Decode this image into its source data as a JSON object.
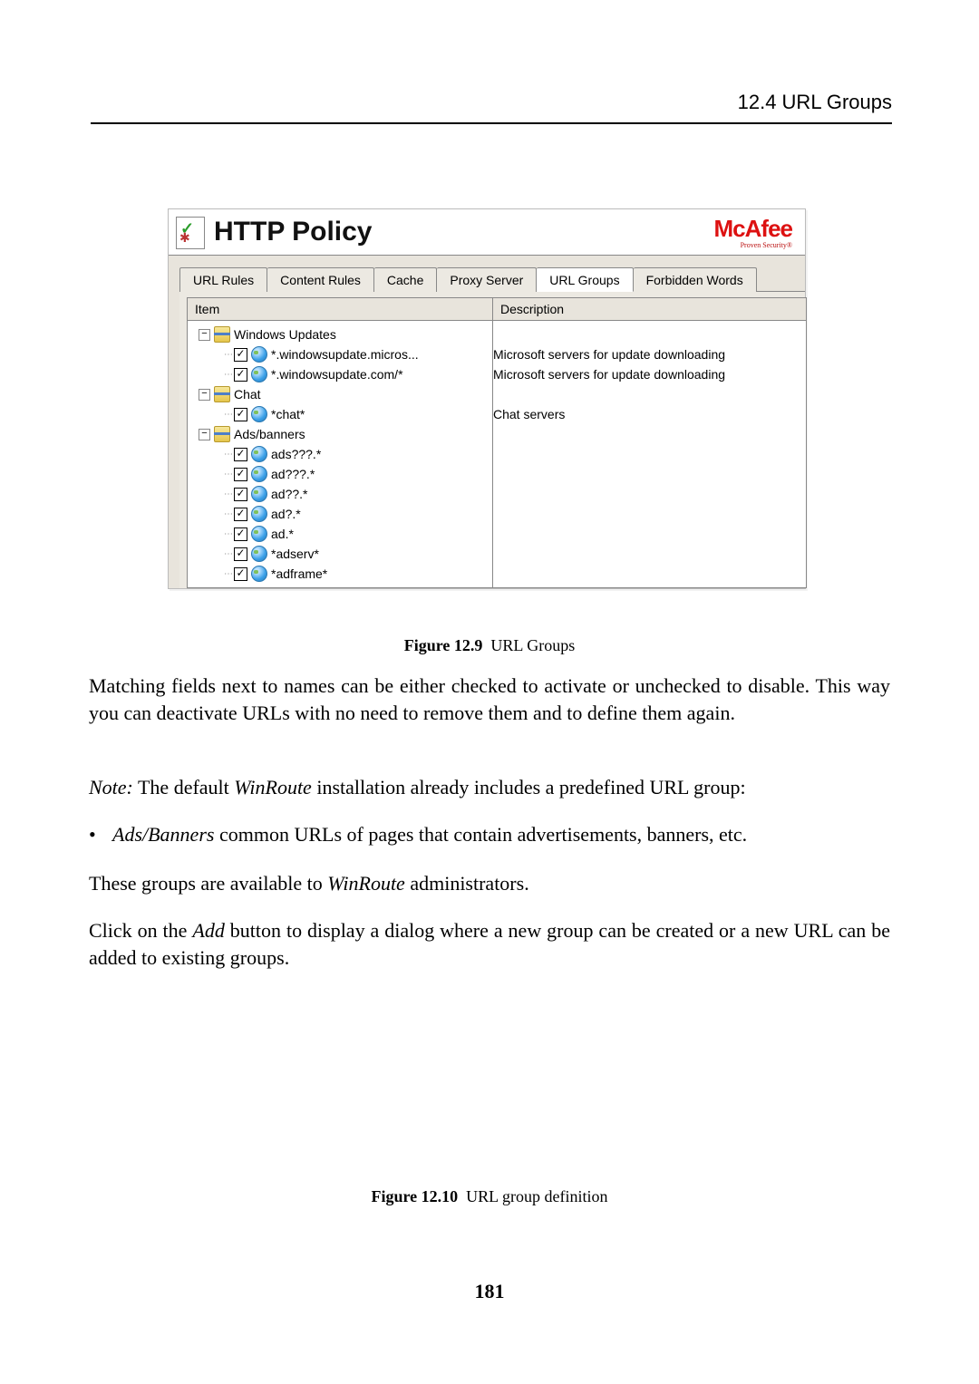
{
  "header": {
    "section_label": "12.4  URL Groups"
  },
  "figure": {
    "title": "HTTP Policy",
    "brand": "McAfee",
    "brand_sub": "Proven Security®",
    "tabs": [
      "URL Rules",
      "Content Rules",
      "Cache",
      "Proxy Server",
      "URL Groups",
      "Forbidden Words"
    ],
    "active_tab_index": 4,
    "columns": {
      "item": "Item",
      "description": "Description"
    },
    "tree": [
      {
        "type": "group",
        "label": "Windows Updates",
        "children": [
          {
            "checked": true,
            "icon": "globe",
            "label": "*.windowsupdate.micros...",
            "desc": "Microsoft servers for update downloading"
          },
          {
            "checked": true,
            "icon": "globe",
            "label": "*.windowsupdate.com/*",
            "desc": "Microsoft servers for update downloading"
          }
        ]
      },
      {
        "type": "group",
        "label": "Chat",
        "children": [
          {
            "checked": true,
            "icon": "globe",
            "label": "*chat*",
            "desc": "Chat servers"
          }
        ]
      },
      {
        "type": "group",
        "label": "Ads/banners",
        "children": [
          {
            "checked": true,
            "icon": "globe",
            "label": "ads???.*",
            "desc": ""
          },
          {
            "checked": true,
            "icon": "globe",
            "label": "ad???.*",
            "desc": ""
          },
          {
            "checked": true,
            "icon": "globe",
            "label": "ad??.*",
            "desc": ""
          },
          {
            "checked": true,
            "icon": "globe",
            "label": "ad?.*",
            "desc": ""
          },
          {
            "checked": true,
            "icon": "globe",
            "label": "ad.*",
            "desc": ""
          },
          {
            "checked": true,
            "icon": "globe",
            "label": "*adserv*",
            "desc": ""
          },
          {
            "checked": true,
            "icon": "globe",
            "label": "*adframe*",
            "desc": ""
          }
        ]
      }
    ]
  },
  "captions": {
    "fig1_bold": "Figure 12.9",
    "fig1_rest": "URL Groups",
    "fig2_bold": "Figure 12.10",
    "fig2_rest": "URL group definition"
  },
  "paras": {
    "p1": "Matching fields next to names can be either checked to activate or unchecked to disable. This way you can deactivate URLs with no need to remove them and to define them again.",
    "p2_pre": "Note:",
    "p2_mid": " The default ",
    "p2_it": "WinRoute",
    "p2_post": " installation already includes a predefined URL group:",
    "bullet_it": "Ads/Banners",
    "bullet_rest": " common URLs of pages that contain advertisements, banners, etc.",
    "p3_pre": "These groups are available to ",
    "p3_it": "WinRoute",
    "p3_post": " administrators.",
    "p4_pre": "Click on the ",
    "p4_it": "Add",
    "p4_post": " button to display a dialog where a new group can be created or a new URL can be added to existing groups."
  },
  "page_number": "181"
}
